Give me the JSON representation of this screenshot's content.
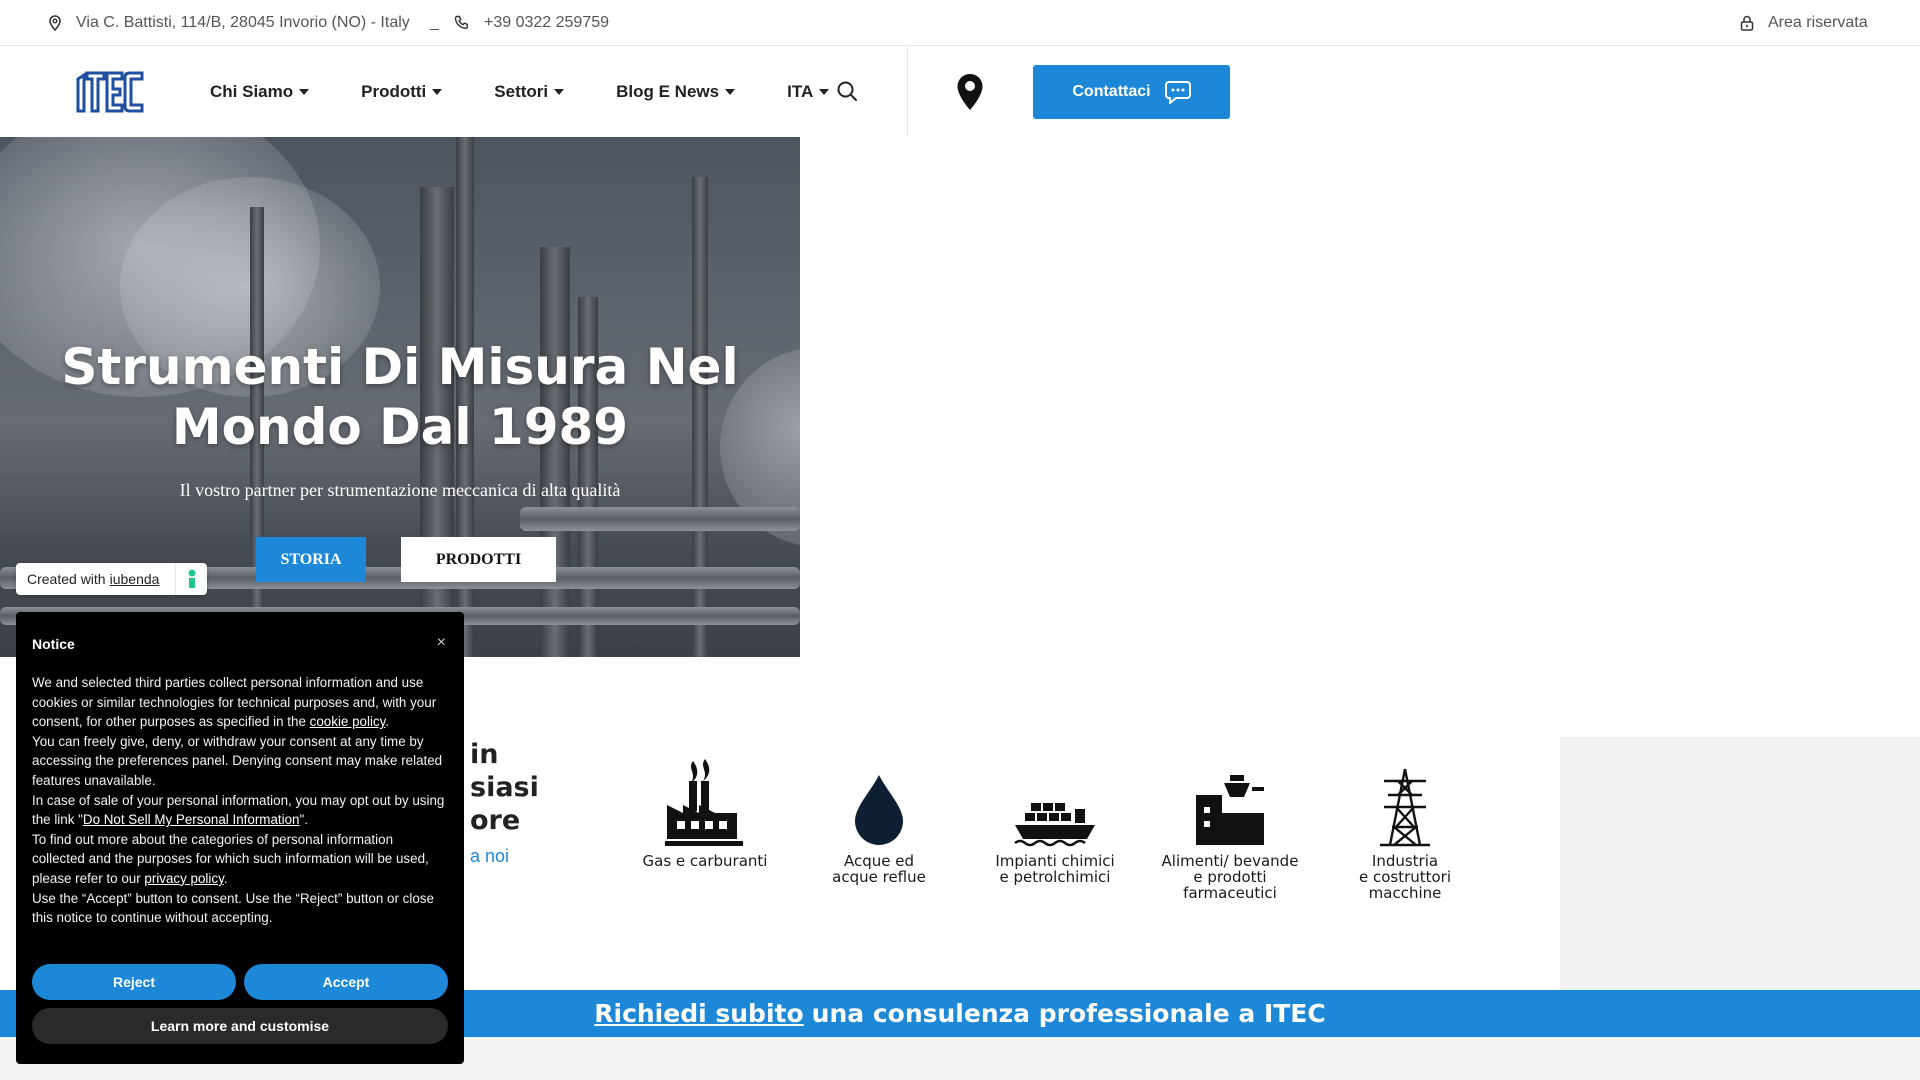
{
  "topbar": {
    "address": "Via C. Battisti, 114/B, 28045 Invorio (NO) - Italy",
    "separator": "_",
    "phone": "+39 0322 259759",
    "reserved_area": "Area riservata"
  },
  "header": {
    "logo_text": "ITEC",
    "nav": [
      {
        "label": "Chi Siamo"
      },
      {
        "label": "Prodotti"
      },
      {
        "label": "Settori"
      },
      {
        "label": "Blog E News"
      },
      {
        "label": "ITA"
      }
    ],
    "contact_label": "Contattaci",
    "brand_color": "#1e88d8"
  },
  "hero": {
    "title_line1": "Strumenti Di Misura Nel",
    "title_line2": "Mondo Dal 1989",
    "subtitle": "Il vostro partner per strumentazione meccanica di alta qualità",
    "btn_storia": "STORIA",
    "btn_prodotti": "PRODOTTI"
  },
  "iubenda": {
    "prefix": "Created with",
    "link": "iubenda"
  },
  "sectors": {
    "heading_line1": "in",
    "heading_line2": "siasi",
    "heading_line3": "ore",
    "link": "a noi",
    "items": [
      {
        "line1": "Gas e carburanti",
        "line2": "",
        "line3": "",
        "icon": "factory-icon"
      },
      {
        "line1": "Acque ed",
        "line2": "acque reflue",
        "line3": "",
        "icon": "water-drop-icon"
      },
      {
        "line1": "Impianti chimici",
        "line2": "e petrolchimici",
        "line3": "",
        "icon": "ship-icon"
      },
      {
        "line1": "Alimenti/ bevande",
        "line2": "e prodotti",
        "line3": "farmaceutici",
        "icon": "food-machine-icon"
      },
      {
        "line1": "Industria",
        "line2": "e costruttori",
        "line3": "macchine",
        "icon": "pylon-icon"
      }
    ]
  },
  "cta": {
    "link": "Richiedi subito",
    "rest": "una consulenza professionale a ITEC"
  },
  "cookie": {
    "title": "Notice",
    "close": "×",
    "p1_a": "We and selected third parties collect personal information and use cookies or similar technologies for technical purposes and, with your consent, for other purposes as specified in the ",
    "p1_link": "cookie policy",
    "p1_b": ".",
    "p2": "You can freely give, deny, or withdraw your consent at any time by accessing the preferences panel. Denying consent may make related features unavailable.",
    "p3_a": "In case of sale of your personal information, you may opt out by using the link \"",
    "p3_link": "Do Not Sell My Personal Information",
    "p3_b": "\".",
    "p4_a": "To find out more about the categories of personal information collected and the purposes for which such information will be used, please refer to our ",
    "p4_link": "privacy policy",
    "p4_b": ".",
    "p5": "Use the “Accept” button to consent. Use the “Reject” button or close this notice to continue without accepting.",
    "reject": "Reject",
    "accept": "Accept",
    "learn_more": "Learn more and customise"
  }
}
